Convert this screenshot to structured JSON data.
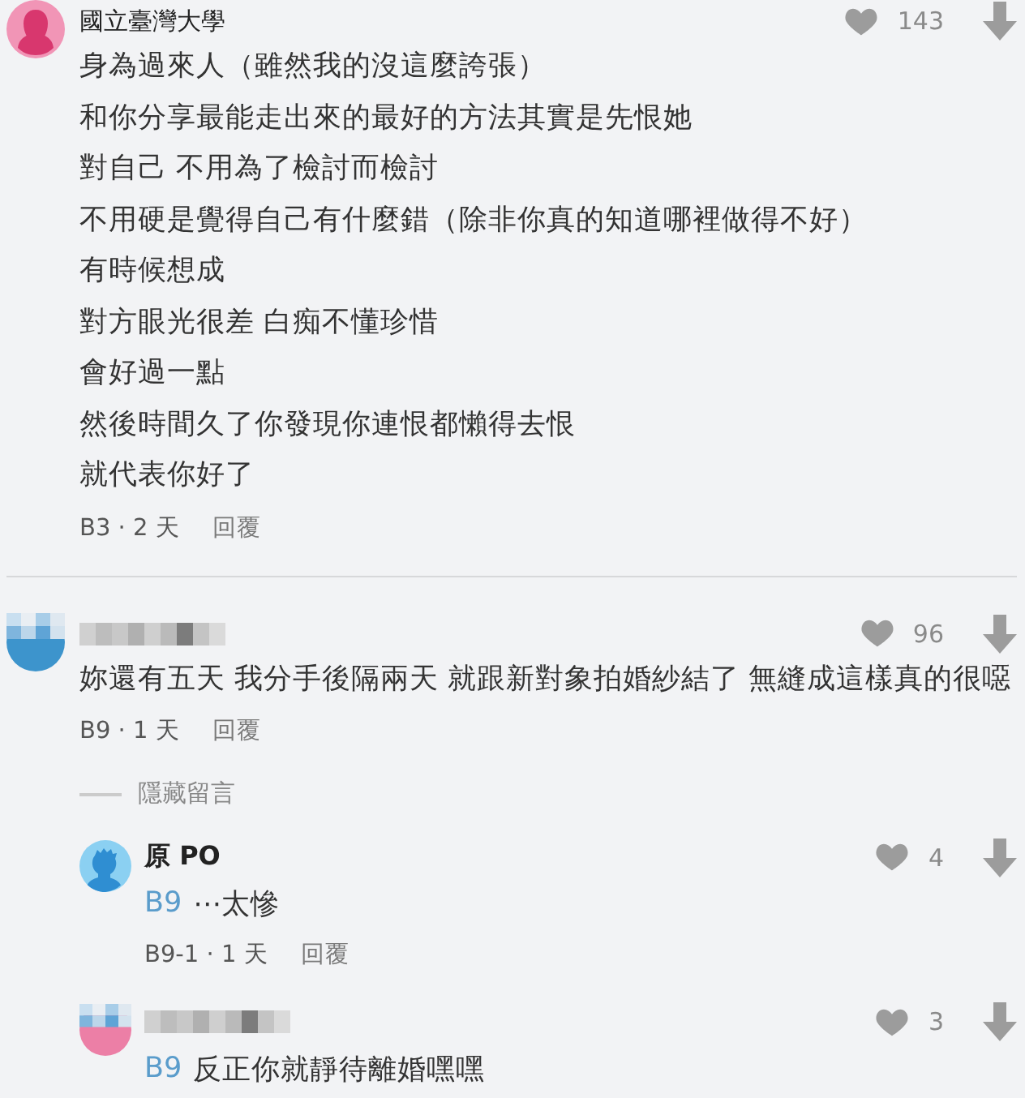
{
  "comments": [
    {
      "avatar": {
        "kind": "female",
        "color": "#f195b6"
      },
      "author": {
        "kind": "plain",
        "name": "國立臺灣大學"
      },
      "likes": "143",
      "lines": [
        "身為過來人（雖然我的沒這麼誇張）",
        "和你分享最能走出來的最好的方法其實是先恨她",
        "對自己 不用為了檢討而檢討",
        "不用硬是覺得自己有什麼錯（除非你真的知道哪裡做得不好）",
        "有時候想成",
        "對方眼光很差 白痴不懂珍惜",
        "會好過一點",
        "然後時間久了你發現你連恨都懶得去恨",
        "就代表你好了"
      ],
      "meta": "B3 · 2 天",
      "reply_label": "回覆"
    },
    {
      "avatar": {
        "kind": "pixelated",
        "color": "#3d94cc"
      },
      "author": {
        "kind": "pixelated"
      },
      "likes": "96",
      "lines": [
        "妳還有五天 我分手後隔兩天 就跟新對象拍婚紗結了 無縫成這樣真的很噁"
      ],
      "meta": "B9 · 1 天",
      "reply_label": "回覆",
      "hide_label": "隱藏留言",
      "replies": [
        {
          "avatar": {
            "kind": "male",
            "color": "#8bd0f2"
          },
          "author": {
            "kind": "bold",
            "name": "原 PO"
          },
          "likes": "4",
          "mention": "B9",
          "text": "⋯太慘",
          "meta": "B9-1 · 1 天",
          "reply_label": "回覆"
        },
        {
          "avatar": {
            "kind": "pixelated",
            "color": "#ec7fa6"
          },
          "author": {
            "kind": "pixelated"
          },
          "likes": "3",
          "mention": "B9",
          "text": "反正你就靜待離婚嘿嘿"
        }
      ]
    }
  ]
}
